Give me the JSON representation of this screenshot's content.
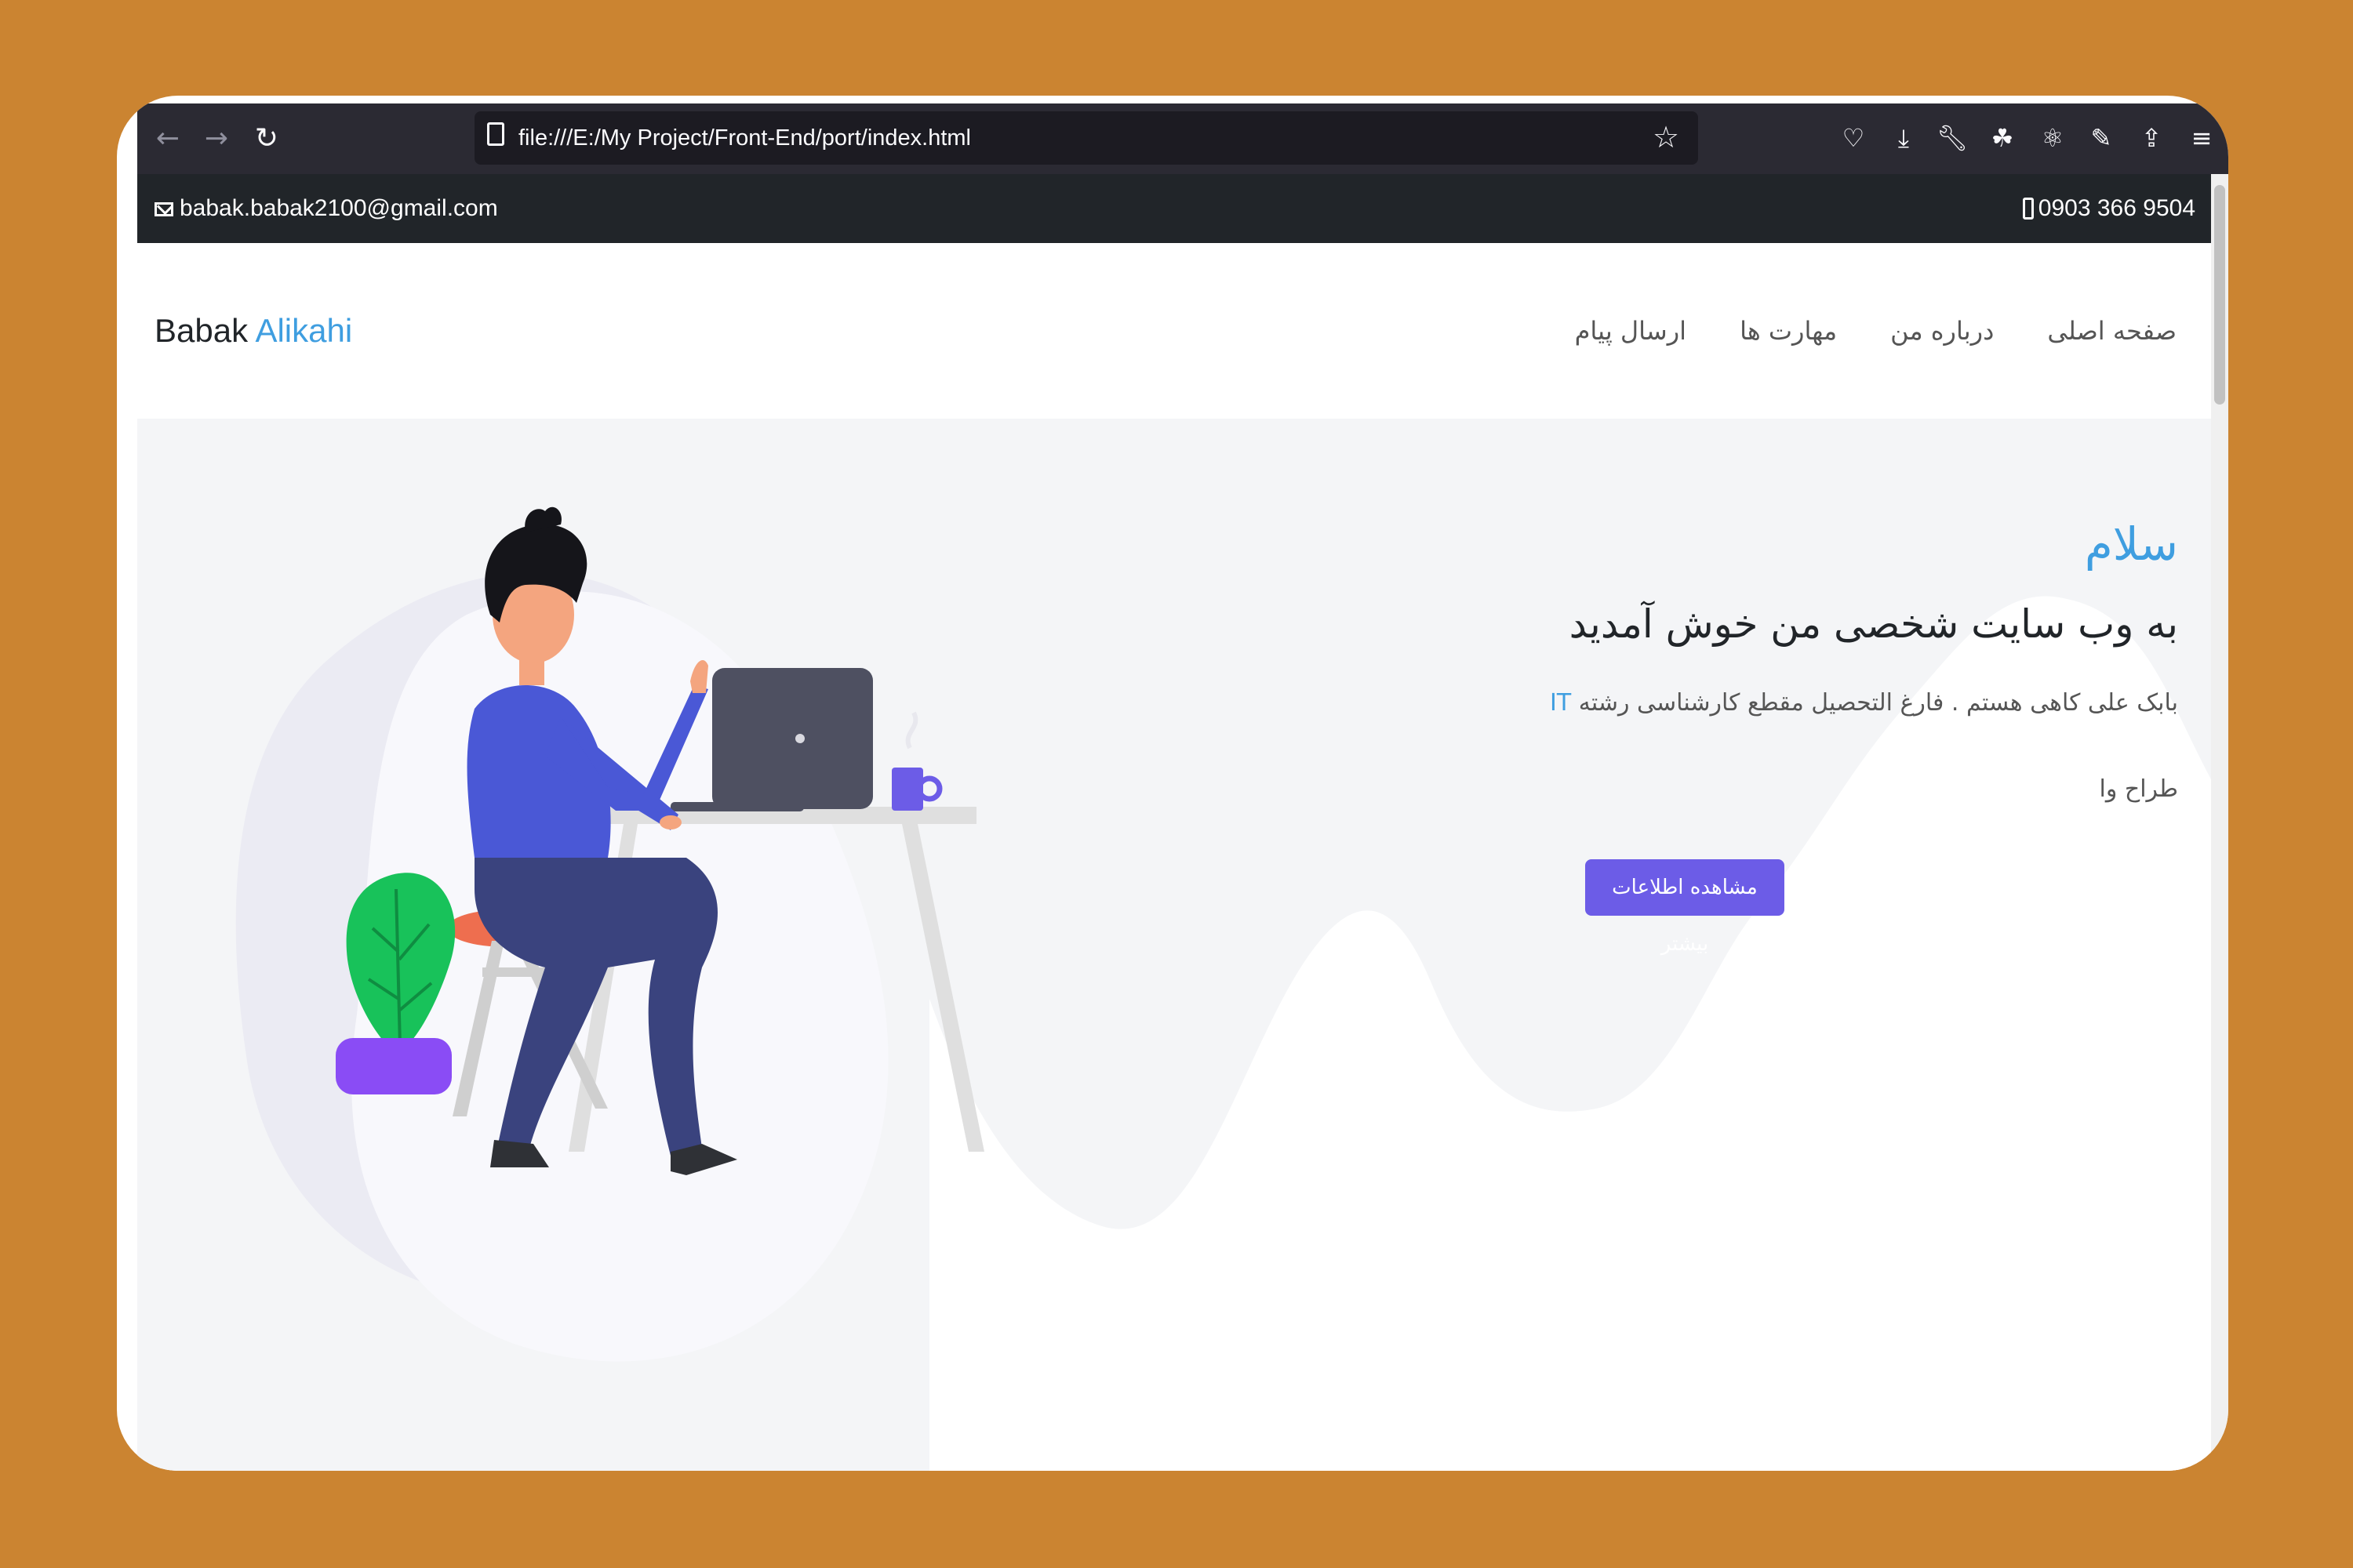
{
  "browser": {
    "url": "file:///E:/My Project/Front-End/port/index.html",
    "icons": [
      "back-icon",
      "forward-icon",
      "reload-icon",
      "page-icon",
      "bookmark-star-icon",
      "pocket-icon",
      "download-icon",
      "wrench-icon",
      "extension-icon",
      "atom-icon",
      "pen-icon",
      "share-icon",
      "menu-icon"
    ]
  },
  "topbar": {
    "email": "babak.babak2100@gmail.com",
    "phone": "0903 366 9504"
  },
  "navbar": {
    "brand_first": "Babak",
    "brand_last": "Alikahi",
    "links": [
      "صفحه اصلی",
      "درباره من",
      "مهارت ها",
      "ارسال پیام"
    ]
  },
  "hero": {
    "greeting": "سلام",
    "welcome": "به وب سایت شخصی من خوش آمدید",
    "intro": "بابک علی کاهی هستم . فارغ التحصیل مقطع کارشناسی رشته",
    "intro_highlight": "IT",
    "role": "طراح وا",
    "button": "مشاهده اطلاعات بیشتر"
  },
  "colors": {
    "accent": "#3f9ee0",
    "button": "#6c5ce7",
    "background": "#cb8431",
    "topbar": "#212529"
  }
}
